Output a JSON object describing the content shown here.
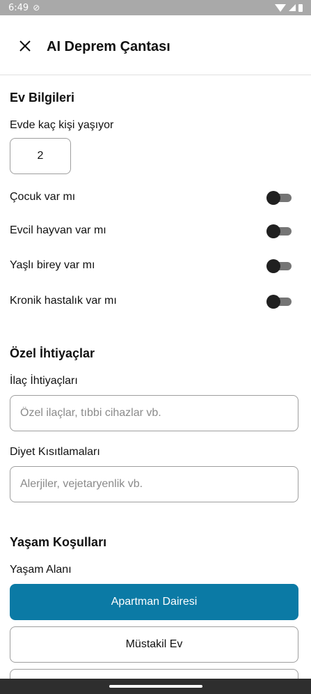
{
  "status": {
    "time": "6:49"
  },
  "header": {
    "title": "AI Deprem Çantası"
  },
  "household": {
    "section_title": "Ev Bilgileri",
    "people_label": "Evde kaç kişi yaşıyor",
    "people_count": "2",
    "toggles": [
      {
        "label": "Çocuk var mı",
        "on": false
      },
      {
        "label": "Evcil hayvan var mı",
        "on": false
      },
      {
        "label": "Yaşlı birey var mı",
        "on": false
      },
      {
        "label": "Kronik hastalık var mı",
        "on": false
      }
    ]
  },
  "special_needs": {
    "section_title": "Özel İhtiyaçlar",
    "medication_label": "İlaç İhtiyaçları",
    "medication_placeholder": "Özel ilaçlar, tıbbi cihazlar vb.",
    "diet_label": "Diyet Kısıtlamaları",
    "diet_placeholder": "Alerjiler, vejetaryenlik vb."
  },
  "living": {
    "section_title": "Yaşam Koşulları",
    "area_label": "Yaşam Alanı",
    "options": [
      {
        "label": "Apartman Dairesi",
        "selected": true
      },
      {
        "label": "Müstakil Ev",
        "selected": false
      }
    ]
  },
  "colors": {
    "accent": "#0b7aa5",
    "status_bar": "#a9a9a9",
    "nav_bar": "#2e2e2e"
  }
}
